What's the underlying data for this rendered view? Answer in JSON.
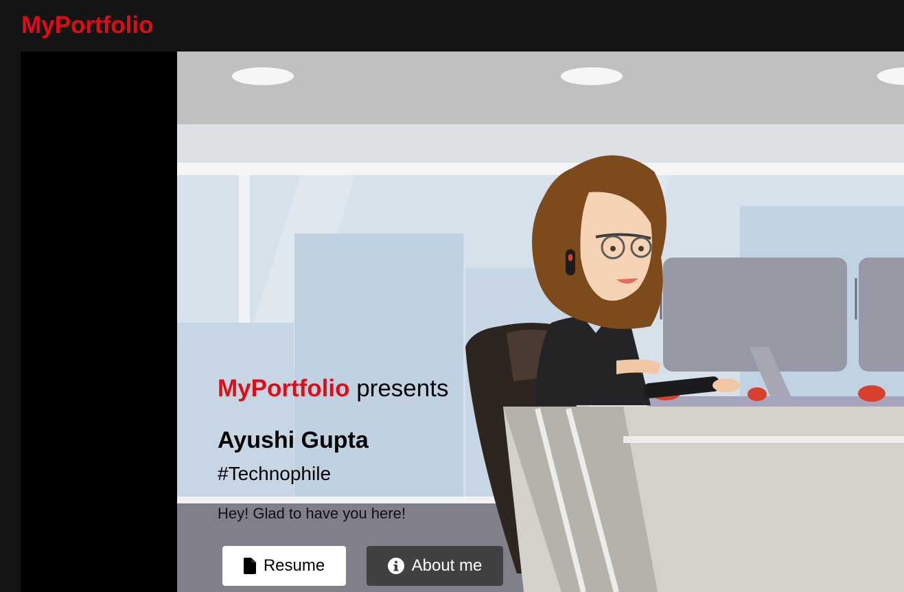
{
  "navbar": {
    "brand": "MyPortfolio"
  },
  "hero": {
    "presents_brand": "MyPortfolio",
    "presents_text": " presents",
    "name": "Ayushi Gupta",
    "tagline": "#Technophile",
    "greeting": "Hey! Glad to have you here!",
    "buttons": {
      "resume": {
        "label": "Resume",
        "icon": "file-icon"
      },
      "about": {
        "label": "About me",
        "icon": "info-circle-icon"
      }
    },
    "image": {
      "subject": "cartoon-woman-at-office-desk-illustration"
    }
  },
  "colors": {
    "brand_red": "#e50914",
    "nav_bg": "#141414",
    "resume_button_bg": "#ffffff",
    "about_button_bg": "#414143"
  }
}
